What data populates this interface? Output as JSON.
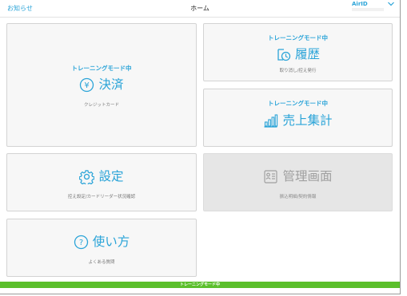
{
  "header": {
    "notice_label": "お知らせ",
    "title": "ホーム",
    "account_label": "AirID"
  },
  "tiles": {
    "payment": {
      "mode": "トレーニングモード中",
      "label": "決済",
      "sub": "クレジットカード",
      "icon": "yen-circle-icon"
    },
    "history": {
      "mode": "トレーニングモード中",
      "label": "履歴",
      "sub": "取り消し/控え発行",
      "icon": "history-clock-icon"
    },
    "sales": {
      "mode": "トレーニングモード中",
      "label": "売上集計",
      "sub": "",
      "icon": "bar-chart-icon"
    },
    "settings": {
      "label": "設定",
      "sub": "控え設定/カードリーダー状況確認",
      "icon": "gear-icon"
    },
    "management": {
      "label": "管理画面",
      "sub": "振込明細/契約情報",
      "icon": "profile-document-icon"
    },
    "help": {
      "label": "使い方",
      "sub": "よくある質問",
      "icon": "question-circle-icon"
    }
  },
  "footer": {
    "label": "トレーニングモード中"
  },
  "colors": {
    "accent": "#2ba4d8",
    "training_bar": "#5bbf2c",
    "disabled_text": "#a0a0a0"
  }
}
